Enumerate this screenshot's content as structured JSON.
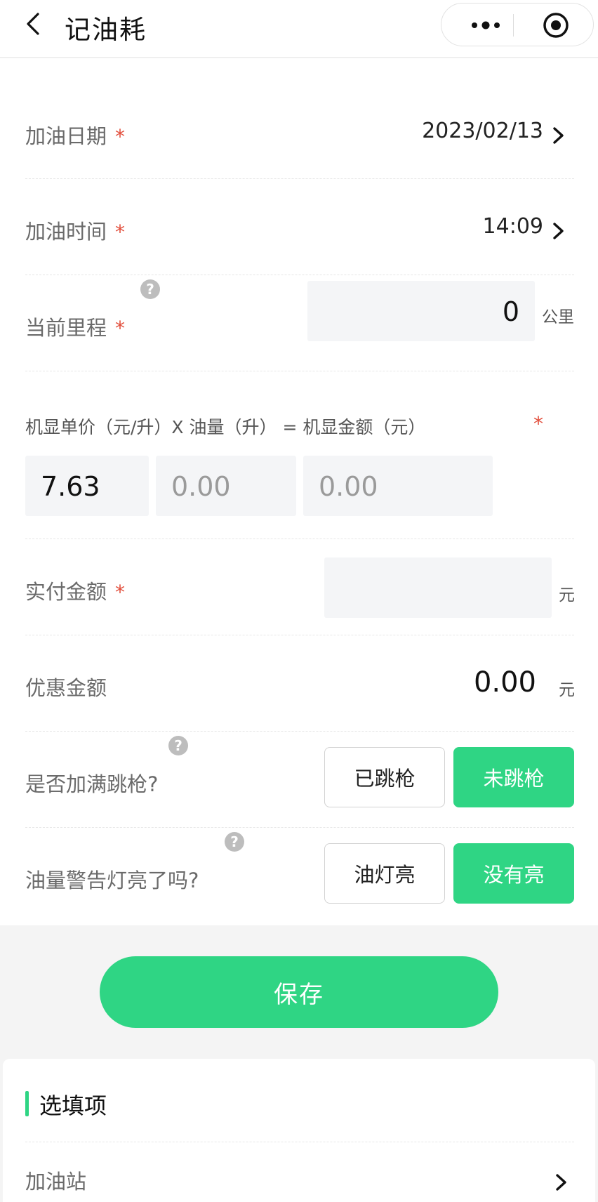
{
  "nav": {
    "title": "记油耗"
  },
  "colors": {
    "accent": "#2fd584",
    "required_star": "#e24f3d"
  },
  "form": {
    "required_mark": "*",
    "date": {
      "label": "加油日期",
      "value": "2023/02/13"
    },
    "time": {
      "label": "加油时间",
      "value": "14:09"
    },
    "mileage": {
      "label": "当前里程",
      "value": "0",
      "unit": "公里",
      "help": "?"
    },
    "price_row": {
      "label": "机显单价（元/升）X 油量（升） = 机显金额（元）",
      "unit_price": "7.63",
      "volume_placeholder": "0.00",
      "amount_placeholder": "0.00"
    },
    "paid": {
      "label": "实付金额",
      "value": "",
      "unit": "元"
    },
    "discount": {
      "label": "优惠金额",
      "value": "0.00",
      "unit": "元"
    },
    "full_tank": {
      "label": "是否加满跳枪?",
      "help": "?",
      "option_yes": "已跳枪",
      "option_no": "未跳枪",
      "selected": "未跳枪"
    },
    "warning_light": {
      "label": "油量警告灯亮了吗?",
      "help": "?",
      "option_yes": "油灯亮",
      "option_no": "没有亮",
      "selected": "没有亮"
    }
  },
  "save_button": "保存",
  "optional": {
    "title": "选填项",
    "station_label": "加油站"
  }
}
